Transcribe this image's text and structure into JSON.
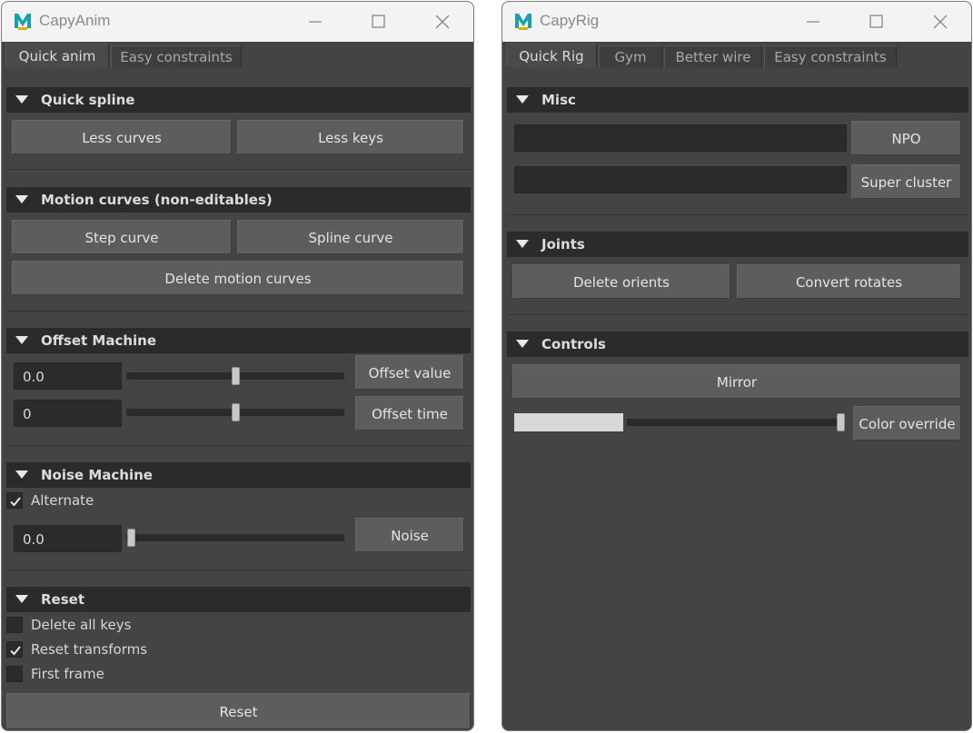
{
  "anim": {
    "title": "CapyAnim",
    "tabs": [
      "Quick anim",
      "Easy constraints"
    ],
    "quick_spline": {
      "header": "Quick spline",
      "less_curves": "Less curves",
      "less_keys": "Less keys"
    },
    "motion_curves": {
      "header": "Motion curves (non-editables)",
      "step_curve": "Step curve",
      "spline_curve": "Spline curve",
      "delete": "Delete motion curves"
    },
    "offset_machine": {
      "header": "Offset Machine",
      "value_field": "0.0",
      "value_slider": 0.5,
      "value_button": "Offset value",
      "time_field": "0",
      "time_slider": 0.5,
      "time_button": "Offset time"
    },
    "noise_machine": {
      "header": "Noise Machine",
      "alternate_label": "Alternate",
      "alternate_checked": true,
      "field": "0.0",
      "slider": 0.0,
      "button": "Noise"
    },
    "reset": {
      "header": "Reset",
      "delete_all_keys": "Delete all keys",
      "delete_all_keys_checked": false,
      "reset_transforms": "Reset transforms",
      "reset_transforms_checked": true,
      "first_frame": "First frame",
      "first_frame_checked": false,
      "button": "Reset"
    }
  },
  "rig": {
    "title": "CapyRig",
    "tabs": [
      "Quick Rig",
      "Gym",
      "Better wire",
      "Easy constraints"
    ],
    "misc": {
      "header": "Misc",
      "npo_field": "",
      "npo_button": "NPO",
      "cluster_field": "",
      "cluster_button": "Super cluster"
    },
    "joints": {
      "header": "Joints",
      "delete_orients": "Delete orients",
      "convert_rotates": "Convert rotates"
    },
    "controls": {
      "header": "Controls",
      "mirror": "Mirror",
      "color_slider": 1.0,
      "color_override": "Color override",
      "swatch_color": "#d8d8d8"
    }
  },
  "colors": {
    "panel": "#444444",
    "header": "#2b2b2b",
    "button": "#5d5d5d",
    "logo": "#1a9fb0"
  }
}
